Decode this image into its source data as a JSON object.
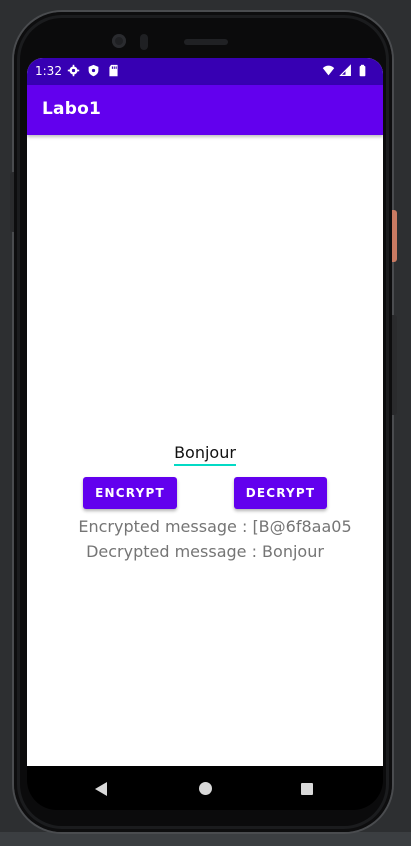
{
  "status_bar": {
    "time": "1:32",
    "left_icons": [
      "gear-icon",
      "shield-icon",
      "sd-card-icon"
    ],
    "right_icons": [
      "wifi-icon",
      "signal-icon",
      "battery-icon"
    ],
    "color": "#3700b3"
  },
  "app_bar": {
    "title": "Labo1",
    "color": "#6200ee"
  },
  "form": {
    "input_value": "Bonjour",
    "encrypt_label": "ENCRYPT",
    "decrypt_label": "DECRYPT",
    "accent_color": "#03dac5"
  },
  "messages": {
    "encrypted": "Encrypted message : [B@6f8aa05",
    "decrypted": "Decrypted message :  Bonjour"
  },
  "nav_bar": {
    "icons": [
      "back-icon",
      "home-icon",
      "recents-icon"
    ]
  }
}
